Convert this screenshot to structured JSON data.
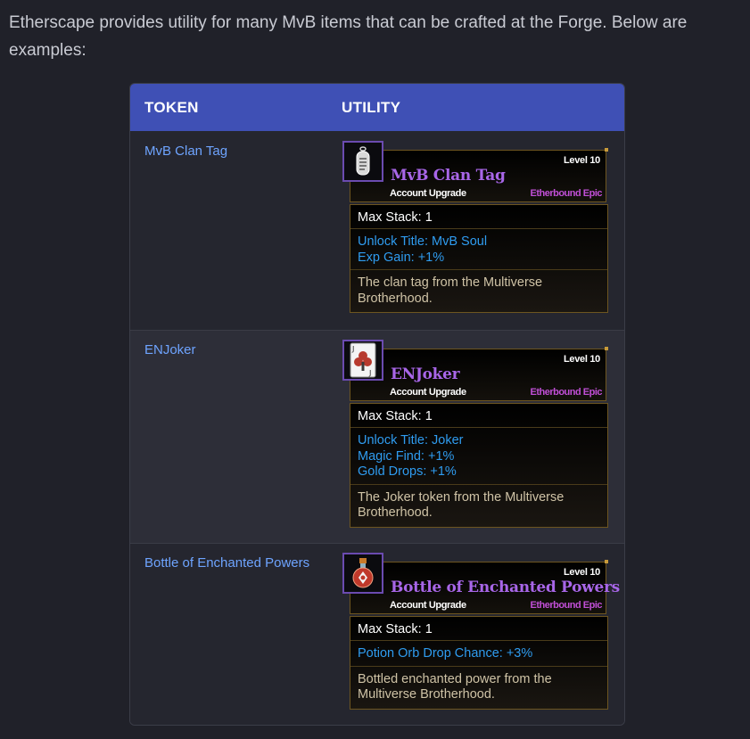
{
  "intro": "Etherscape provides utility for many MvB items that can be crafted at the Forge. Below are examples:",
  "table": {
    "headers": {
      "token": "TOKEN",
      "utility": "UTILITY"
    },
    "rows": [
      {
        "token": "MvB Clan Tag",
        "card": {
          "icon": "dog-tag-icon",
          "level": "Level 10",
          "name": "MvB Clan Tag",
          "type": "Account Upgrade",
          "rarity": "Etherbound Epic",
          "max_stack": "Max Stack: 1",
          "stats": [
            "Unlock Title: MvB Soul",
            "Exp Gain: +1%"
          ],
          "desc": "The clan tag from the Multiverse Brotherhood."
        }
      },
      {
        "token": "ENJoker",
        "card": {
          "icon": "joker-card-icon",
          "level": "Level 10",
          "name": "ENJoker",
          "type": "Account Upgrade",
          "rarity": "Etherbound Epic",
          "max_stack": "Max Stack: 1",
          "stats": [
            "Unlock Title: Joker",
            "Magic Find: +1%",
            "Gold Drops: +1%"
          ],
          "desc": "The Joker token from the Multiverse Brotherhood."
        }
      },
      {
        "token": "Bottle of Enchanted Powers",
        "card": {
          "icon": "potion-bottle-icon",
          "level": "Level 10",
          "name": "Bottle of Enchanted Powers",
          "type": "Account Upgrade",
          "rarity": "Etherbound Epic",
          "max_stack": "Max Stack: 1",
          "stats": [
            "Potion Orb Drop Chance: +3%"
          ],
          "desc": "Bottled enchanted power from the Multiverse Brotherhood."
        }
      }
    ]
  },
  "colors": {
    "background": "#202129",
    "header_bg": "#3f50b5",
    "link": "#6ea4ff",
    "item_name": "#a866e8",
    "stat": "#2f9cf0",
    "rarity": "#c04fd6"
  }
}
